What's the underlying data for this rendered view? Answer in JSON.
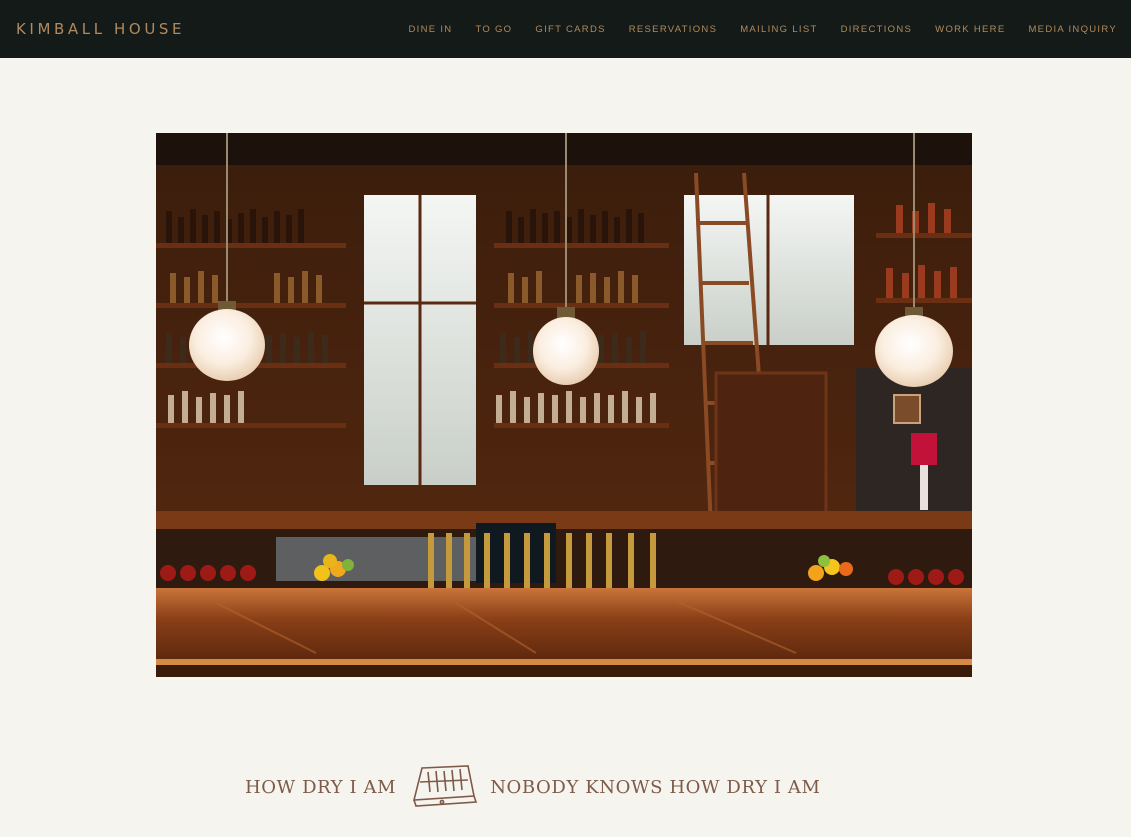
{
  "brand": {
    "name": "KIMBALL HOUSE"
  },
  "nav": {
    "items": [
      {
        "label": "DINE IN"
      },
      {
        "label": "TO GO"
      },
      {
        "label": "GIFT CARDS"
      },
      {
        "label": "RESERVATIONS"
      },
      {
        "label": "MAILING LIST"
      },
      {
        "label": "DIRECTIONS"
      },
      {
        "label": "WORK HERE"
      },
      {
        "label": "MEDIA INQUIRY"
      }
    ]
  },
  "tagline": {
    "left": "HOW DRY I AM",
    "right": "NOBODY KNOWS HOW DRY I AM",
    "icon": "cash-register-icon"
  },
  "colors": {
    "header_bg": "#141a17",
    "accent": "#b08a5e",
    "page_bg": "#f6f4ee",
    "tagline": "#7d5a49"
  }
}
